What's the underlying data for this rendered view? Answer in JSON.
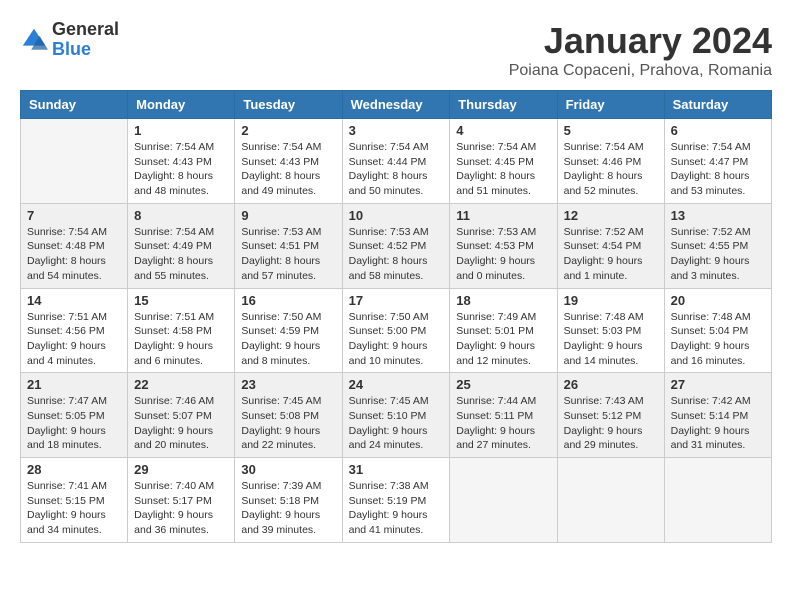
{
  "logo": {
    "general": "General",
    "blue": "Blue"
  },
  "title": "January 2024",
  "subtitle": "Poiana Copaceni, Prahova, Romania",
  "weekdays": [
    "Sunday",
    "Monday",
    "Tuesday",
    "Wednesday",
    "Thursday",
    "Friday",
    "Saturday"
  ],
  "weeks": [
    [
      {
        "day": "",
        "sunrise": "",
        "sunset": "",
        "daylight": ""
      },
      {
        "day": "1",
        "sunrise": "Sunrise: 7:54 AM",
        "sunset": "Sunset: 4:43 PM",
        "daylight": "Daylight: 8 hours and 48 minutes."
      },
      {
        "day": "2",
        "sunrise": "Sunrise: 7:54 AM",
        "sunset": "Sunset: 4:43 PM",
        "daylight": "Daylight: 8 hours and 49 minutes."
      },
      {
        "day": "3",
        "sunrise": "Sunrise: 7:54 AM",
        "sunset": "Sunset: 4:44 PM",
        "daylight": "Daylight: 8 hours and 50 minutes."
      },
      {
        "day": "4",
        "sunrise": "Sunrise: 7:54 AM",
        "sunset": "Sunset: 4:45 PM",
        "daylight": "Daylight: 8 hours and 51 minutes."
      },
      {
        "day": "5",
        "sunrise": "Sunrise: 7:54 AM",
        "sunset": "Sunset: 4:46 PM",
        "daylight": "Daylight: 8 hours and 52 minutes."
      },
      {
        "day": "6",
        "sunrise": "Sunrise: 7:54 AM",
        "sunset": "Sunset: 4:47 PM",
        "daylight": "Daylight: 8 hours and 53 minutes."
      }
    ],
    [
      {
        "day": "7",
        "sunrise": "Sunrise: 7:54 AM",
        "sunset": "Sunset: 4:48 PM",
        "daylight": "Daylight: 8 hours and 54 minutes."
      },
      {
        "day": "8",
        "sunrise": "Sunrise: 7:54 AM",
        "sunset": "Sunset: 4:49 PM",
        "daylight": "Daylight: 8 hours and 55 minutes."
      },
      {
        "day": "9",
        "sunrise": "Sunrise: 7:53 AM",
        "sunset": "Sunset: 4:51 PM",
        "daylight": "Daylight: 8 hours and 57 minutes."
      },
      {
        "day": "10",
        "sunrise": "Sunrise: 7:53 AM",
        "sunset": "Sunset: 4:52 PM",
        "daylight": "Daylight: 8 hours and 58 minutes."
      },
      {
        "day": "11",
        "sunrise": "Sunrise: 7:53 AM",
        "sunset": "Sunset: 4:53 PM",
        "daylight": "Daylight: 9 hours and 0 minutes."
      },
      {
        "day": "12",
        "sunrise": "Sunrise: 7:52 AM",
        "sunset": "Sunset: 4:54 PM",
        "daylight": "Daylight: 9 hours and 1 minute."
      },
      {
        "day": "13",
        "sunrise": "Sunrise: 7:52 AM",
        "sunset": "Sunset: 4:55 PM",
        "daylight": "Daylight: 9 hours and 3 minutes."
      }
    ],
    [
      {
        "day": "14",
        "sunrise": "Sunrise: 7:51 AM",
        "sunset": "Sunset: 4:56 PM",
        "daylight": "Daylight: 9 hours and 4 minutes."
      },
      {
        "day": "15",
        "sunrise": "Sunrise: 7:51 AM",
        "sunset": "Sunset: 4:58 PM",
        "daylight": "Daylight: 9 hours and 6 minutes."
      },
      {
        "day": "16",
        "sunrise": "Sunrise: 7:50 AM",
        "sunset": "Sunset: 4:59 PM",
        "daylight": "Daylight: 9 hours and 8 minutes."
      },
      {
        "day": "17",
        "sunrise": "Sunrise: 7:50 AM",
        "sunset": "Sunset: 5:00 PM",
        "daylight": "Daylight: 9 hours and 10 minutes."
      },
      {
        "day": "18",
        "sunrise": "Sunrise: 7:49 AM",
        "sunset": "Sunset: 5:01 PM",
        "daylight": "Daylight: 9 hours and 12 minutes."
      },
      {
        "day": "19",
        "sunrise": "Sunrise: 7:48 AM",
        "sunset": "Sunset: 5:03 PM",
        "daylight": "Daylight: 9 hours and 14 minutes."
      },
      {
        "day": "20",
        "sunrise": "Sunrise: 7:48 AM",
        "sunset": "Sunset: 5:04 PM",
        "daylight": "Daylight: 9 hours and 16 minutes."
      }
    ],
    [
      {
        "day": "21",
        "sunrise": "Sunrise: 7:47 AM",
        "sunset": "Sunset: 5:05 PM",
        "daylight": "Daylight: 9 hours and 18 minutes."
      },
      {
        "day": "22",
        "sunrise": "Sunrise: 7:46 AM",
        "sunset": "Sunset: 5:07 PM",
        "daylight": "Daylight: 9 hours and 20 minutes."
      },
      {
        "day": "23",
        "sunrise": "Sunrise: 7:45 AM",
        "sunset": "Sunset: 5:08 PM",
        "daylight": "Daylight: 9 hours and 22 minutes."
      },
      {
        "day": "24",
        "sunrise": "Sunrise: 7:45 AM",
        "sunset": "Sunset: 5:10 PM",
        "daylight": "Daylight: 9 hours and 24 minutes."
      },
      {
        "day": "25",
        "sunrise": "Sunrise: 7:44 AM",
        "sunset": "Sunset: 5:11 PM",
        "daylight": "Daylight: 9 hours and 27 minutes."
      },
      {
        "day": "26",
        "sunrise": "Sunrise: 7:43 AM",
        "sunset": "Sunset: 5:12 PM",
        "daylight": "Daylight: 9 hours and 29 minutes."
      },
      {
        "day": "27",
        "sunrise": "Sunrise: 7:42 AM",
        "sunset": "Sunset: 5:14 PM",
        "daylight": "Daylight: 9 hours and 31 minutes."
      }
    ],
    [
      {
        "day": "28",
        "sunrise": "Sunrise: 7:41 AM",
        "sunset": "Sunset: 5:15 PM",
        "daylight": "Daylight: 9 hours and 34 minutes."
      },
      {
        "day": "29",
        "sunrise": "Sunrise: 7:40 AM",
        "sunset": "Sunset: 5:17 PM",
        "daylight": "Daylight: 9 hours and 36 minutes."
      },
      {
        "day": "30",
        "sunrise": "Sunrise: 7:39 AM",
        "sunset": "Sunset: 5:18 PM",
        "daylight": "Daylight: 9 hours and 39 minutes."
      },
      {
        "day": "31",
        "sunrise": "Sunrise: 7:38 AM",
        "sunset": "Sunset: 5:19 PM",
        "daylight": "Daylight: 9 hours and 41 minutes."
      },
      {
        "day": "",
        "sunrise": "",
        "sunset": "",
        "daylight": ""
      },
      {
        "day": "",
        "sunrise": "",
        "sunset": "",
        "daylight": ""
      },
      {
        "day": "",
        "sunrise": "",
        "sunset": "",
        "daylight": ""
      }
    ]
  ]
}
